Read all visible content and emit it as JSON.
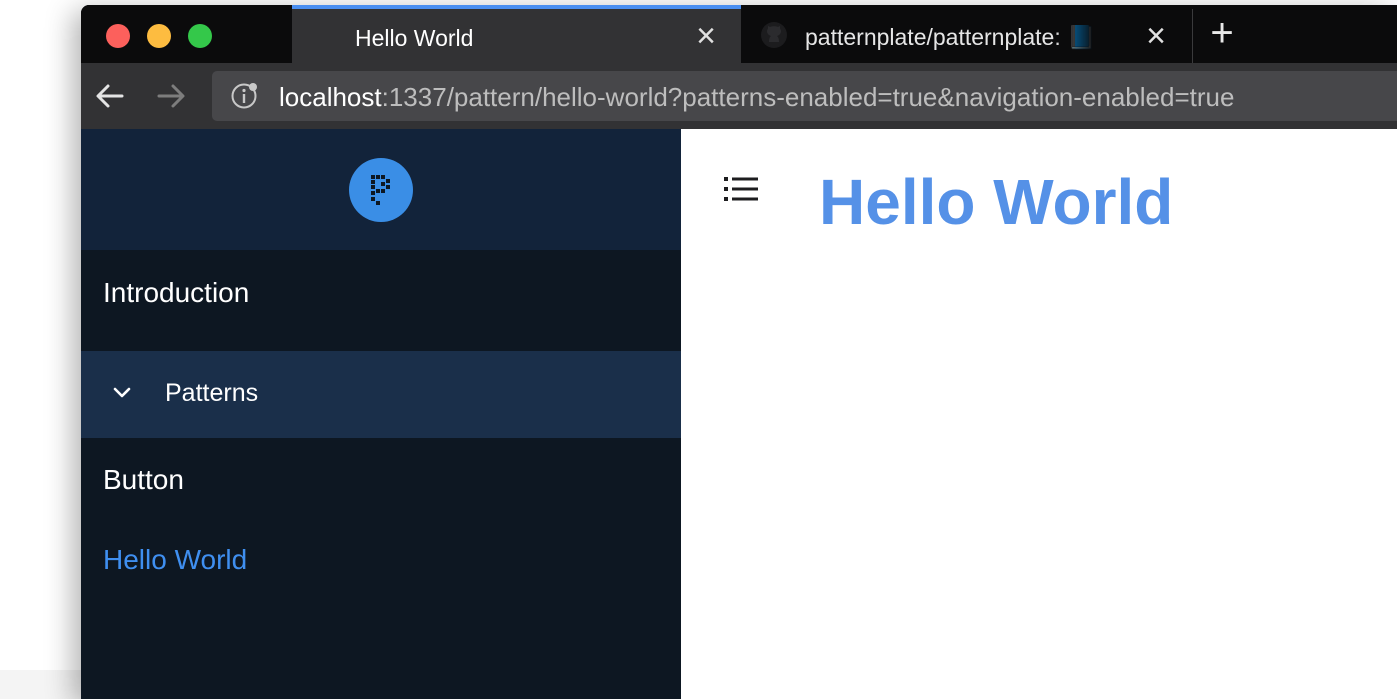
{
  "browser": {
    "tabs": [
      {
        "title": "Hello World",
        "active": true
      },
      {
        "title": "patternplate/patternplate: 📘 Doc",
        "active": false
      }
    ],
    "url": {
      "host": "localhost",
      "rest": ":1337/pattern/hello-world?patterns-enabled=true&navigation-enabled=true"
    },
    "icons": {
      "back": "arrow-left-icon",
      "forward": "arrow-right-icon",
      "info": "info-icon",
      "close": "close-icon",
      "new_tab": "plus-icon",
      "github": "github-icon"
    }
  },
  "sidebar": {
    "logo": "patternplate-logo",
    "items": [
      {
        "label": "Introduction"
      },
      {
        "label": "Patterns",
        "expanded": true
      },
      {
        "label": "Button"
      },
      {
        "label": "Hello World",
        "active": true
      }
    ]
  },
  "main": {
    "toc_icon": "list-icon",
    "title": "Hello World"
  },
  "colors": {
    "accent": "#3f8ff0",
    "title": "#5591e7",
    "sidebar_bg": "#0d1722",
    "sidebar_header_bg": "#12233a",
    "sidebar_active_folder_bg": "#1a2f4a"
  }
}
